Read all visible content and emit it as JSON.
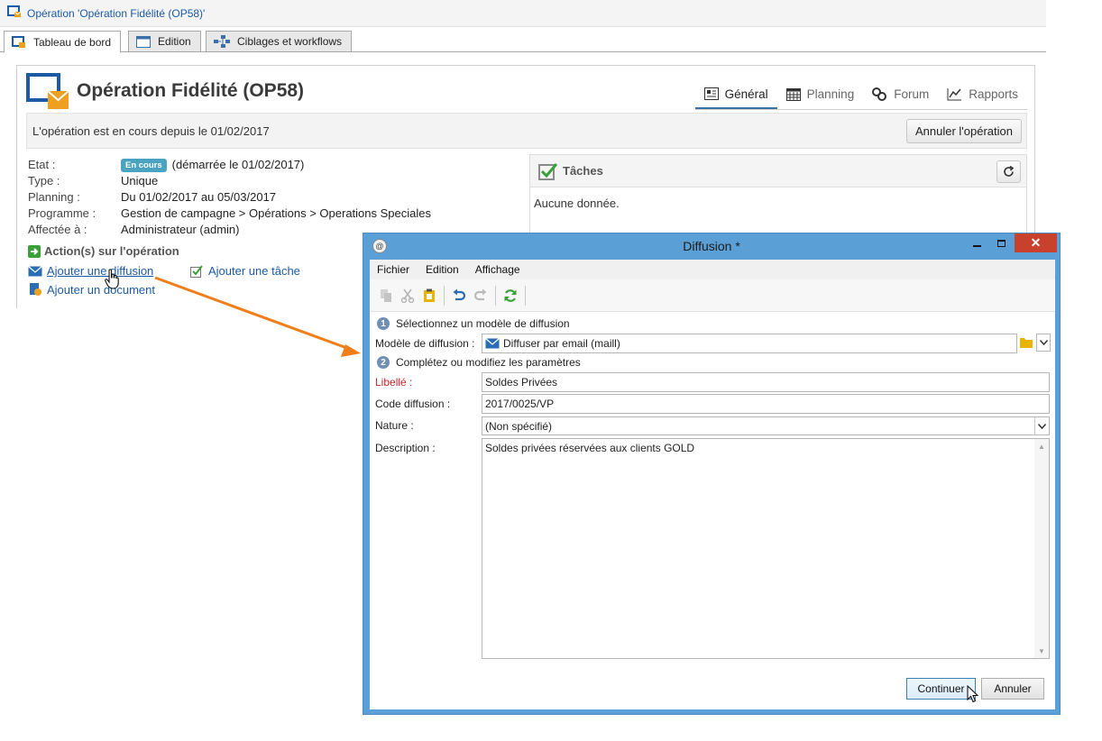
{
  "window": {
    "title": "Opération 'Opération Fidélité (OP58)'"
  },
  "tabs": [
    {
      "label": "Tableau de bord",
      "active": true,
      "icon": "dashboard-icon"
    },
    {
      "label": "Edition",
      "active": false,
      "icon": "form-icon"
    },
    {
      "label": "Ciblages et workflows",
      "active": false,
      "icon": "workflow-icon"
    }
  ],
  "operation": {
    "title": "Opération Fidélité (OP58)"
  },
  "right_nav": [
    {
      "label": "Général",
      "active": true,
      "icon": "list-icon"
    },
    {
      "label": "Planning",
      "active": false,
      "icon": "calendar-icon"
    },
    {
      "label": "Forum",
      "active": false,
      "icon": "forum-icon"
    },
    {
      "label": "Rapports",
      "active": false,
      "icon": "chart-icon"
    }
  ],
  "status": {
    "text": "L'opération est en cours depuis le 01/02/2017",
    "cancel_label": "Annuler l'opération"
  },
  "info": {
    "etat_label": "Etat :",
    "etat_badge": "En cours",
    "etat_value": "(démarrée le 01/02/2017)",
    "type_label": "Type :",
    "type_value": "Unique",
    "planning_label": "Planning :",
    "planning_value": "Du 01/02/2017 au 05/03/2017",
    "programme_label": "Programme :",
    "programme_value": "Gestion de campagne > Opérations > Operations Speciales",
    "affectee_label": "Affectée à :",
    "affectee_value": "Administrateur (admin)"
  },
  "actions": {
    "title": "Action(s) sur l'opération",
    "add_delivery": "Ajouter une diffusion",
    "add_task": "Ajouter une tâche",
    "add_document": "Ajouter un document"
  },
  "tasks": {
    "title": "Tâches",
    "empty": "Aucune donnée."
  },
  "dialog": {
    "title": "Diffusion *",
    "menu": [
      "Fichier",
      "Edition",
      "Affichage"
    ],
    "step1": {
      "num": "1",
      "label": "Sélectionnez un modèle de diffusion"
    },
    "step2": {
      "num": "2",
      "label": "Complétez ou modifiez les paramètres"
    },
    "model_label": "Modèle de diffusion :",
    "model_value": "Diffuser par email (maill)",
    "libelle_label": "Libellé :",
    "libelle_value": "Soldes Privées",
    "code_label": "Code diffusion :",
    "code_value": "2017/0025/VP",
    "nature_label": "Nature :",
    "nature_value": "(Non spécifié)",
    "description_label": "Description :",
    "description_value": "Soldes privées réservées aux clients GOLD",
    "continue_label": "Continuer",
    "cancel_label": "Annuler"
  },
  "colors": {
    "accent": "#1c5aa6",
    "arrow": "#f07e1a",
    "dialog_frame": "#5a9fd6",
    "close_button": "#c7412c",
    "badge": "#4aa3c0",
    "required": "#c4262e"
  }
}
